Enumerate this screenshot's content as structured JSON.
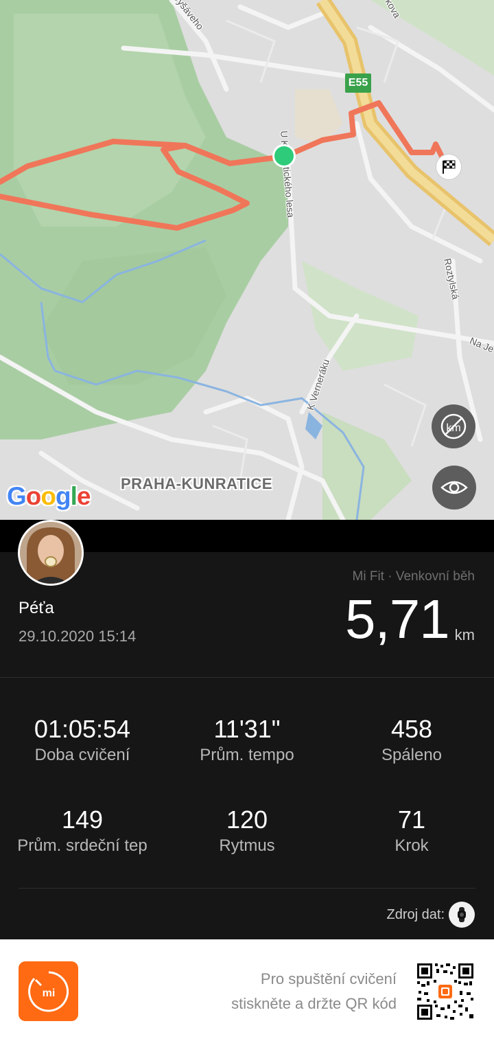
{
  "map": {
    "place_label": "PRAHA-KUNRATICE",
    "road_labels": [
      "vyšáveho",
      "kova",
      "U K",
      "tického lesa",
      "Roztylská",
      "Na Je",
      "K Verneráku"
    ],
    "highway_shield": "E55",
    "google_logo": [
      "G",
      "o",
      "o",
      "g",
      "l",
      "e"
    ],
    "route_color": "#f0765a",
    "start_marker_color": "#2ecc7a",
    "finish_icon": "checkered-flag-icon",
    "controls": {
      "km_toggle_icon": "km-markers-off-icon",
      "visibility_icon": "eye-icon"
    }
  },
  "workout": {
    "user_name": "Péťa",
    "date": "29.10.2020 15:14",
    "source": "Mi Fit · Venkovní běh",
    "distance_value": "5,71",
    "distance_unit": "km",
    "stats": [
      {
        "value": "01:05:54",
        "label": "Doba cvičení"
      },
      {
        "value": "11'31\"",
        "label": "Prům. tempo"
      },
      {
        "value": "458",
        "label": "Spáleno"
      },
      {
        "value": "149",
        "label": "Prům. srdeční tep"
      },
      {
        "value": "120",
        "label": "Rytmus"
      },
      {
        "value": "71",
        "label": "Krok"
      }
    ],
    "data_source_label": "Zdroj dat:",
    "data_source_icon": "watch-device-icon"
  },
  "footer": {
    "app_logo": "mi-fit-logo",
    "promo_line1": "Pro spuštění cvičení",
    "promo_line2": "stiskněte a držte QR kód",
    "qr_icon": "qr-code-icon",
    "accent": "#ff6a13"
  }
}
